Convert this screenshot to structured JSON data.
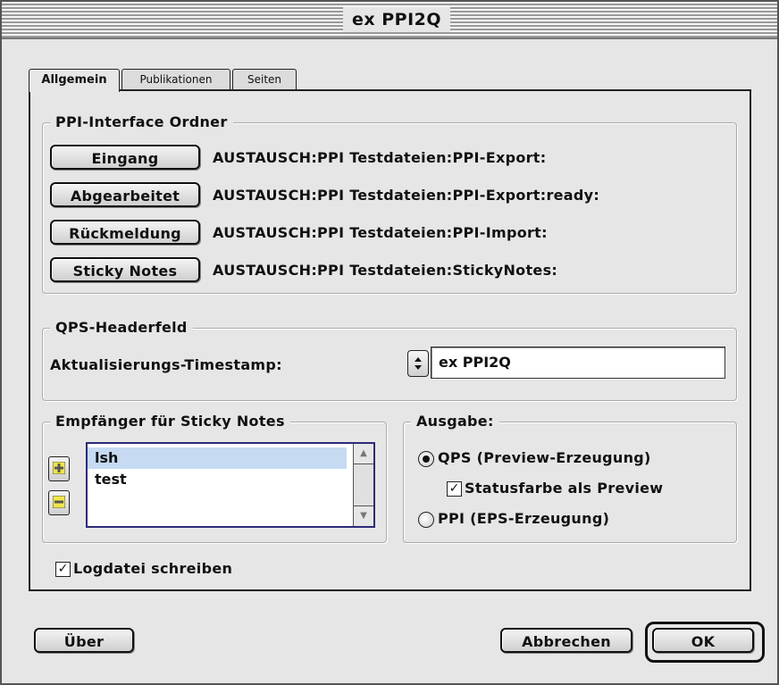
{
  "window": {
    "title": "ex PPI2Q"
  },
  "tabs": [
    {
      "label": "Allgemein",
      "active": true
    },
    {
      "label": "Publikationen",
      "active": false
    },
    {
      "label": "Seiten",
      "active": false
    }
  ],
  "ppi_interface": {
    "title": "PPI-Interface Ordner",
    "rows": [
      {
        "button": "Eingang",
        "path": "AUSTAUSCH:PPI Testdateien:PPI-Export:"
      },
      {
        "button": "Abgearbeitet",
        "path": "AUSTAUSCH:PPI Testdateien:PPI-Export:ready:"
      },
      {
        "button": "Rückmeldung",
        "path": "AUSTAUSCH:PPI Testdateien:PPI-Import:"
      },
      {
        "button": "Sticky Notes",
        "path": "AUSTAUSCH:PPI Testdateien:StickyNotes:"
      }
    ]
  },
  "qps_header": {
    "title": "QPS-Headerfeld",
    "label": "Aktualisierungs-Timestamp:",
    "value": "ex PPI2Q"
  },
  "sticky_recipients": {
    "title": "Empfänger für Sticky Notes",
    "items": [
      {
        "label": "lsh",
        "selected": true
      },
      {
        "label": "test",
        "selected": false
      }
    ]
  },
  "output": {
    "title": "Ausgabe:",
    "options": [
      {
        "label": "QPS (Preview-Erzeugung)",
        "selected": true
      },
      {
        "label": "PPI (EPS-Erzeugung)",
        "selected": false
      }
    ],
    "preview_checkbox": {
      "label": "Statusfarbe als Preview",
      "checked": true
    }
  },
  "log_checkbox": {
    "label": "Logdatei schreiben",
    "checked": true
  },
  "footer": {
    "about": "Über",
    "cancel": "Abbrechen",
    "ok": "OK"
  },
  "colors": {
    "list_selection": "#c6daf2",
    "list_border": "#2d2a7a",
    "add_remove_icon": "#f0e64a"
  },
  "icons": {
    "stepper": "up-down-arrows-icon",
    "add": "plus-icon",
    "remove": "minus-icon",
    "check": "checkmark-icon"
  }
}
